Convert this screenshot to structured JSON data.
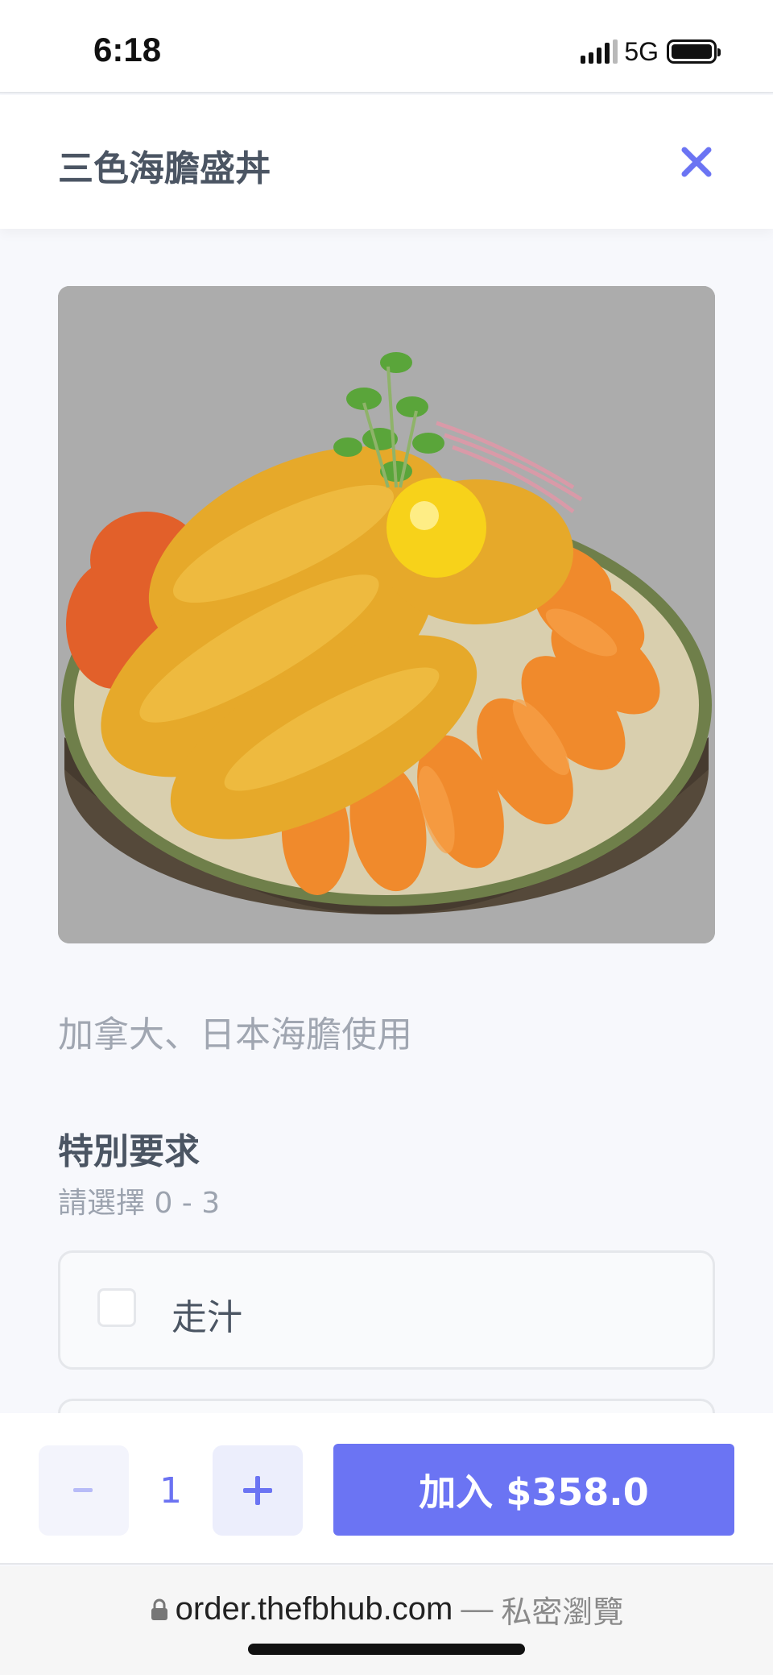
{
  "status_bar": {
    "time": "6:18",
    "network": "5G"
  },
  "header": {
    "title": "三色海膽盛丼"
  },
  "item": {
    "image_alt": "三色海膽盛丼",
    "description": "加拿大、日本海膽使用"
  },
  "special_requests": {
    "title": "特別要求",
    "subtitle": "請選擇 0 - 3",
    "options": [
      {
        "label": "走汁",
        "checked": false
      }
    ]
  },
  "action_bar": {
    "minus_label": "-",
    "quantity": "1",
    "plus_label": "+",
    "add_label": "加入 $358.0"
  },
  "url_bar": {
    "host": "order.thefbhub.com",
    "separator": "—",
    "mode": "私密瀏覽"
  },
  "colors": {
    "accent": "#6b74f3",
    "accent_text": "#6b72f2",
    "close": "#6b74f3"
  }
}
